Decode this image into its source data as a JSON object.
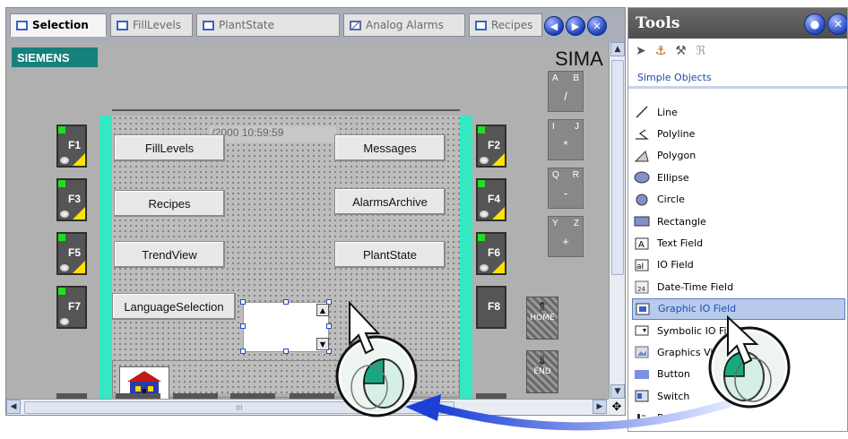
{
  "tabs": [
    {
      "label": "Selection",
      "active": true
    },
    {
      "label": "FillLevels"
    },
    {
      "label": "PlantState"
    },
    {
      "label": "Analog Alarms"
    },
    {
      "label": "Recipes"
    }
  ],
  "nav": {
    "prev": "◀",
    "next": "▶",
    "close": "✕"
  },
  "screen": {
    "brand": "SIEMENS",
    "sima": "SIMA",
    "datetime": "./2000 10:59:59",
    "function_keys": [
      "F1",
      "F2",
      "F3",
      "F4",
      "F5",
      "F6",
      "F7",
      "F8"
    ],
    "buttons": {
      "filllevels": "FillLevels",
      "messages": "Messages",
      "recipes": "Recipes",
      "alarmsarchive": "AlarmsArchive",
      "trendview": "TrendView",
      "plantstate": "PlantState",
      "languageselection": "LanguageSelection"
    },
    "keypads": [
      {
        "a": "A",
        "b": "B",
        "c": "/"
      },
      {
        "a": "I",
        "b": "J",
        "c": "*"
      },
      {
        "a": "Q",
        "b": "R",
        "c": "-"
      },
      {
        "a": "Y",
        "b": "Z",
        "c": "+"
      }
    ],
    "home": "HOME",
    "end": "END"
  },
  "scroll": {
    "up": "▲",
    "down": "▼",
    "left": "◀",
    "right": "▶",
    "grip": "III",
    "corner": "✥"
  },
  "tools": {
    "title": "Tools",
    "section": "Simple Objects",
    "items": [
      {
        "label": "Line",
        "icon": "line-icon"
      },
      {
        "label": "Polyline",
        "icon": "polyline-icon"
      },
      {
        "label": "Polygon",
        "icon": "polygon-icon"
      },
      {
        "label": "Ellipse",
        "icon": "ellipse-icon"
      },
      {
        "label": "Circle",
        "icon": "circle-icon"
      },
      {
        "label": "Rectangle",
        "icon": "rectangle-icon"
      },
      {
        "label": "Text Field",
        "icon": "text-field-icon"
      },
      {
        "label": "IO Field",
        "icon": "io-field-icon"
      },
      {
        "label": "Date-Time Field",
        "icon": "date-time-field-icon"
      },
      {
        "label": "Graphic IO Field",
        "icon": "graphic-io-field-icon",
        "selected": true
      },
      {
        "label": "Symbolic IO Field",
        "icon": "symbolic-io-field-icon"
      },
      {
        "label": "Graphics View",
        "icon": "graphics-view-icon"
      },
      {
        "label": "Button",
        "icon": "button-icon"
      },
      {
        "label": "Switch",
        "icon": "switch-icon"
      },
      {
        "label": "Bar",
        "icon": "bar-icon"
      }
    ]
  },
  "colors": {
    "accent": "#34e8c2",
    "siemens": "#16807c",
    "selection": "#b8cbea"
  }
}
